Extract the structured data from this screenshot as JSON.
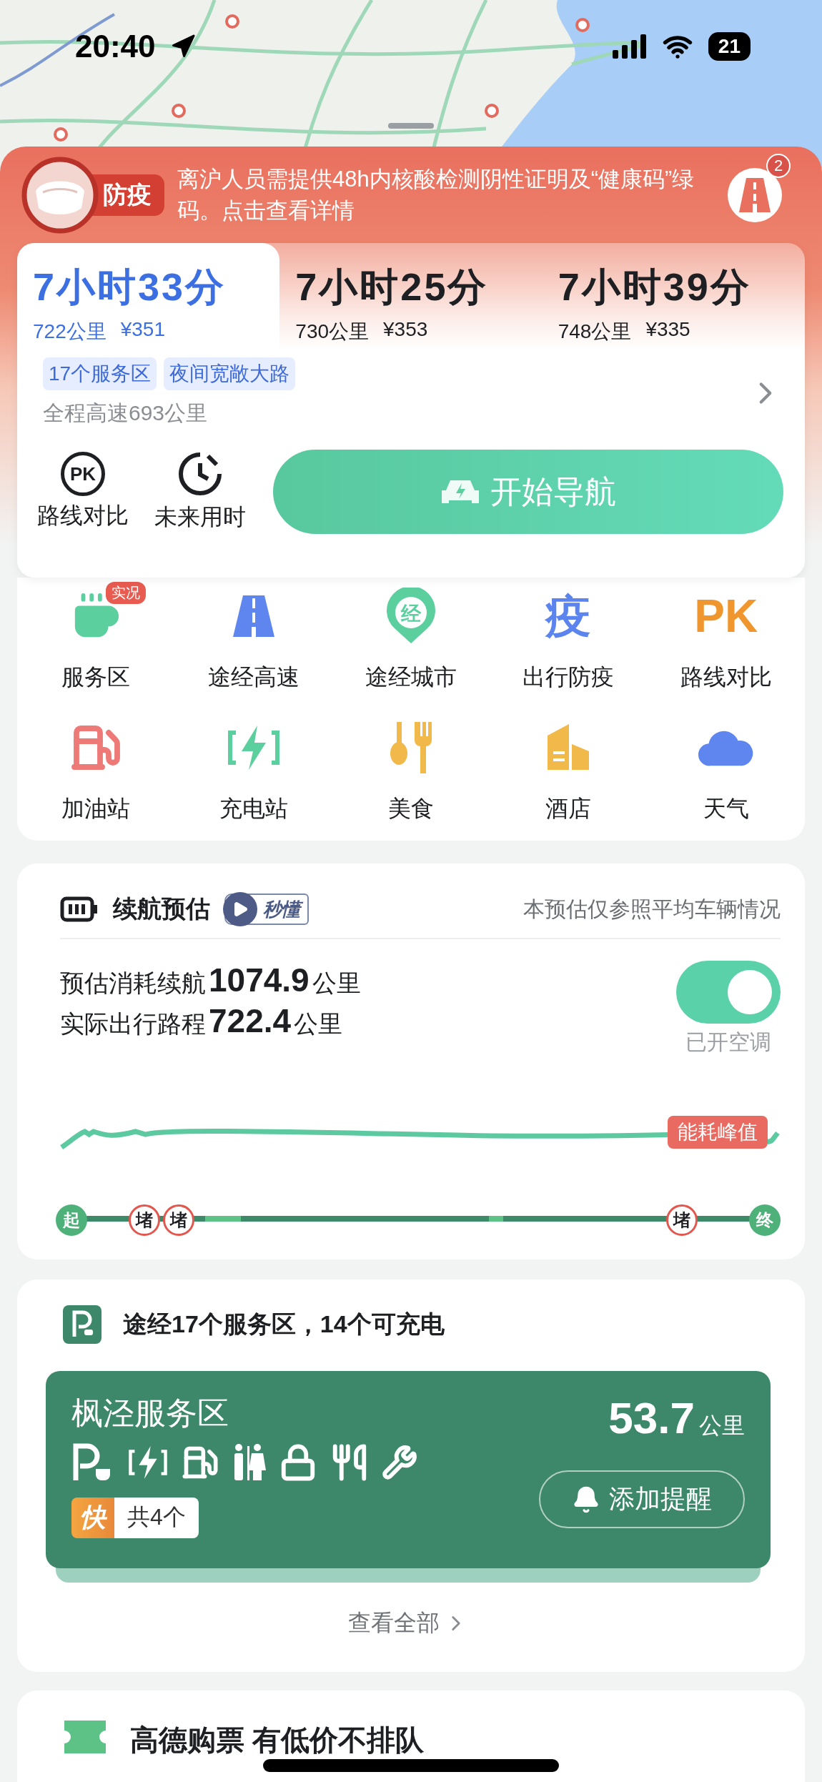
{
  "status_bar": {
    "time": "20:40",
    "battery": "21"
  },
  "notice": {
    "tag": "防疫",
    "text": "离沪人员需提供48h内核酸检测阴性证明及“健康码”绿码。点击查看详情",
    "badge": "2"
  },
  "routes": [
    {
      "time": "7小时33分",
      "distance": "722公里",
      "price": "¥351",
      "selected": true
    },
    {
      "time": "7小时25分",
      "distance": "730公里",
      "price": "¥353",
      "selected": false
    },
    {
      "time": "7小时39分",
      "distance": "748公里",
      "price": "¥335",
      "selected": false
    }
  ],
  "route_tags": [
    "17个服务区",
    "夜间宽敞大路"
  ],
  "route_summary": "全程高速693公里",
  "route_actions": [
    {
      "kind": "pk",
      "glyph": "PK",
      "label": "路线对比"
    },
    {
      "kind": "clock",
      "label": "未来用时"
    }
  ],
  "start_button": "开始导航",
  "tools": [
    {
      "kind": "cup",
      "label": "服务区",
      "badge": "实况"
    },
    {
      "kind": "road",
      "label": "途经高速"
    },
    {
      "kind": "pin",
      "glyph": "经",
      "label": "途经城市"
    },
    {
      "kind": "glyph-blue",
      "glyph": "疫",
      "label": "出行防疫"
    },
    {
      "kind": "glyph-orange",
      "glyph": "PK",
      "label": "路线对比"
    },
    {
      "kind": "fuel",
      "label": "加油站"
    },
    {
      "kind": "charge",
      "label": "充电站"
    },
    {
      "kind": "food",
      "label": "美食"
    },
    {
      "kind": "hotel",
      "label": "酒店"
    },
    {
      "kind": "cloud",
      "label": "天气"
    }
  ],
  "range": {
    "title": "续航预估",
    "video_badge": "秒懂",
    "note": "本预估仅参照平均车辆情况",
    "stats": [
      {
        "label": "预估消耗续航",
        "value": "1074.9",
        "unit": "公里"
      },
      {
        "label": "实际出行路程",
        "value": "722.4",
        "unit": "公里"
      }
    ],
    "ac": {
      "on": true,
      "label": "已开空调"
    },
    "peak_label": "能耗峰值",
    "markers": [
      {
        "kind": "start",
        "text": "起"
      },
      {
        "kind": "jam",
        "text": "堵"
      },
      {
        "kind": "jam",
        "text": "堵"
      },
      {
        "kind": "jam",
        "text": "堵"
      },
      {
        "kind": "end",
        "text": "终"
      }
    ]
  },
  "service": {
    "title": "途经17个服务区，14个可充电",
    "area": {
      "name": "枫泾服务区",
      "distance": "53.7",
      "unit": "公里",
      "fast_tag": "快",
      "charger_count": "共4个",
      "remind_button": "添加提醒",
      "facilities": [
        {
          "kind": "parking"
        },
        {
          "kind": "charge"
        },
        {
          "kind": "fuel"
        },
        {
          "kind": "toilet"
        },
        {
          "kind": "shop"
        },
        {
          "kind": "food"
        },
        {
          "kind": "repair"
        }
      ]
    },
    "view_all": "查看全部"
  },
  "promo": {
    "title": "高德购票 有低价不排队"
  }
}
